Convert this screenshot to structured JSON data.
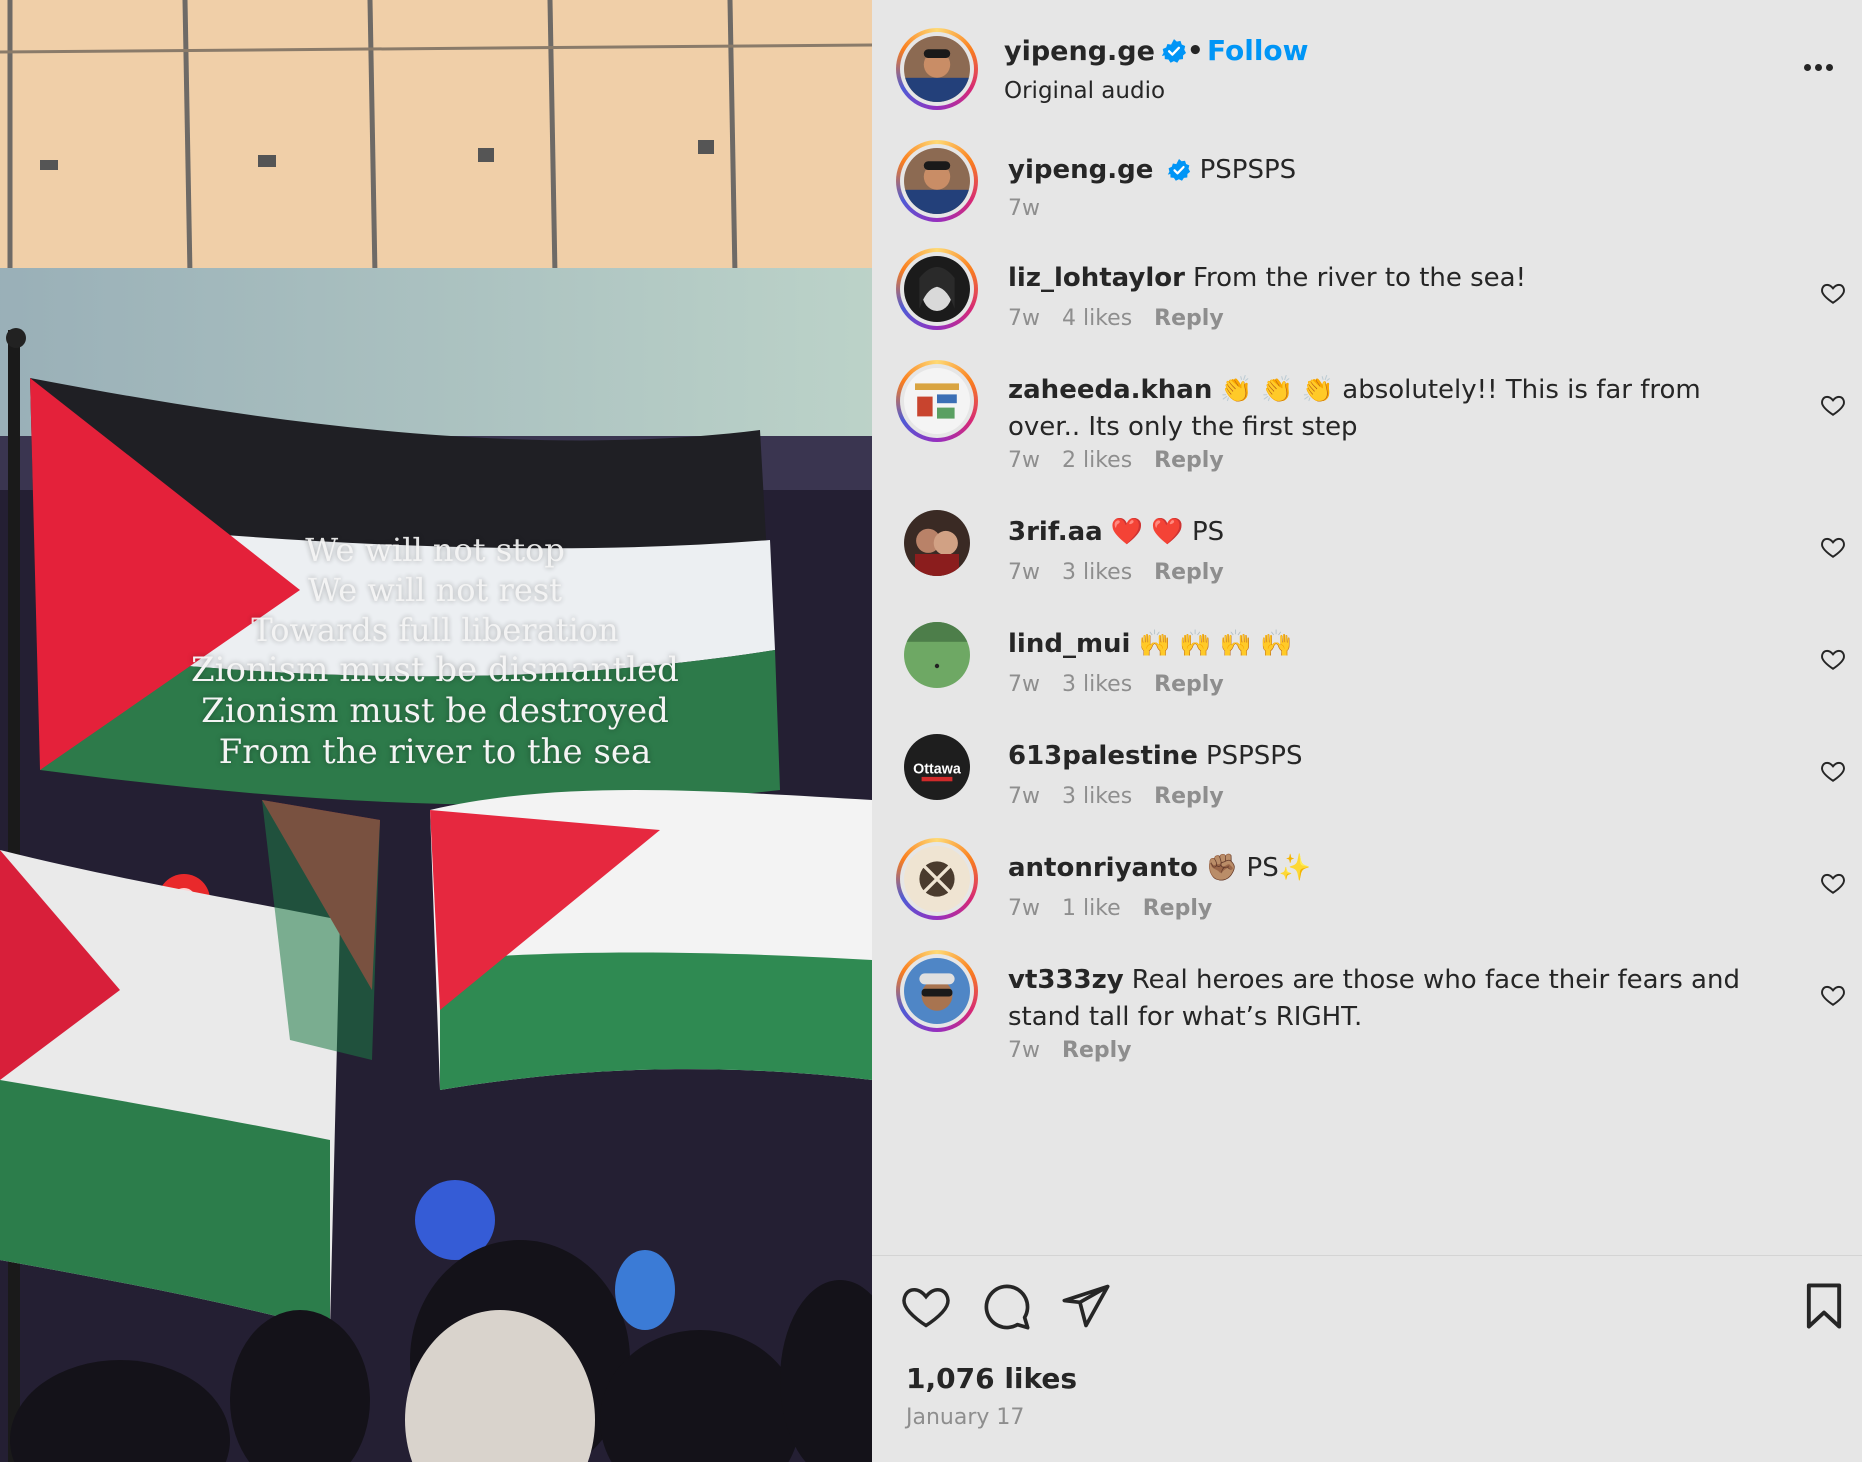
{
  "media": {
    "overlay_lines": [
      "We will not stop",
      "We will not rest",
      "Towards full liberation",
      "Zionism must be dismantled",
      "Zionism must be destroyed",
      "From the river to the sea"
    ]
  },
  "header": {
    "username": "yipeng.ge",
    "separator": "•",
    "follow_label": "Follow",
    "audio": "Original audio",
    "more_icon": "more-horizontal-icon"
  },
  "comments": [
    {
      "username": "yipeng.ge",
      "text": "PSPSPS",
      "time": "7w",
      "likes": "",
      "reply": "",
      "ring": true,
      "avatar": "avatar-yipeng"
    },
    {
      "username": "liz_lohtaylor",
      "text": "From the river to the sea!",
      "time": "7w",
      "likes": "4 likes",
      "reply": "Reply",
      "ring": true,
      "avatar": "avatar-liz"
    },
    {
      "username": "zaheeda.khan",
      "text": "👏 👏 👏 absolutely!! This is far from over.. Its only the first step",
      "time": "7w",
      "likes": "2 likes",
      "reply": "Reply",
      "ring": true,
      "avatar": "avatar-zaheeda"
    },
    {
      "username": "3rif.aa",
      "text": "❤️ ❤️ PS",
      "time": "7w",
      "likes": "3 likes",
      "reply": "Reply",
      "ring": false,
      "avatar": "avatar-3rif"
    },
    {
      "username": "lind_mui",
      "text": "🙌 🙌 🙌 🙌",
      "time": "7w",
      "likes": "3 likes",
      "reply": "Reply",
      "ring": false,
      "avatar": "avatar-lind"
    },
    {
      "username": "613palestine",
      "text": "PSPSPS",
      "time": "7w",
      "likes": "3 likes",
      "reply": "Reply",
      "ring": false,
      "avatar": "avatar-613"
    },
    {
      "username": "antonriyanto",
      "text": "✊🏽 PS✨",
      "time": "7w",
      "likes": "1 like",
      "reply": "Reply",
      "ring": true,
      "avatar": "avatar-anton"
    },
    {
      "username": "vt333zy",
      "text": "Real heroes are those who face their fears and stand tall for what’s RIGHT.",
      "time": "7w",
      "likes": "",
      "reply": "Reply",
      "ring": true,
      "avatar": "avatar-vt"
    }
  ],
  "avatar_613_text": "Ottawa",
  "footer": {
    "likes": "1,076 likes",
    "date": "January 17"
  },
  "colors": {
    "link": "#0095f6",
    "verified": "#0095f6",
    "muted": "#8e8e8e",
    "panel_bg": "#e6e6e6"
  }
}
